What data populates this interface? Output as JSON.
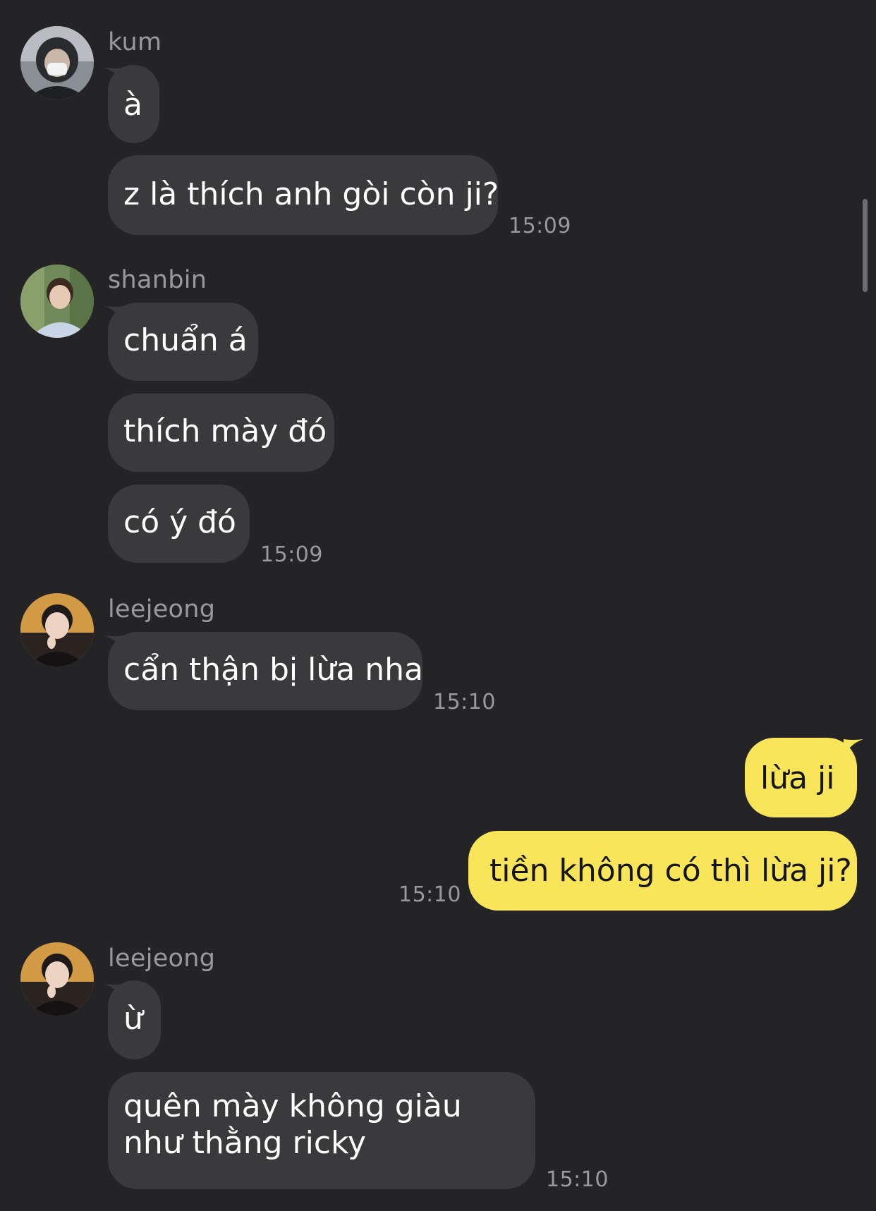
{
  "colors": {
    "background": "#242426",
    "incoming_bubble": "#3a3a3c",
    "outgoing_bubble": "#f9e55a",
    "meta_text": "#9a9a9e"
  },
  "groups": [
    {
      "sender": "kum",
      "avatar": "avatar-kum",
      "messages": [
        "à",
        "z là thích anh gòi còn ji?"
      ],
      "time": "15:09"
    },
    {
      "sender": "shanbin",
      "avatar": "avatar-shanbin",
      "messages": [
        "chuẩn á",
        "thích mày đó",
        "có ý đó"
      ],
      "time": "15:09"
    },
    {
      "sender": "leejeong",
      "avatar": "avatar-leejeong",
      "messages": [
        "cẩn thận bị lừa nha"
      ],
      "time": "15:10"
    },
    {
      "sender": "me",
      "messages": [
        "lừa ji",
        "tiền không có thì lừa ji?"
      ],
      "time": "15:10"
    },
    {
      "sender": "leejeong",
      "avatar": "avatar-leejeong",
      "messages": [
        "ừ",
        "quên mày không giàu như thằng ricky"
      ],
      "time": "15:10"
    }
  ]
}
